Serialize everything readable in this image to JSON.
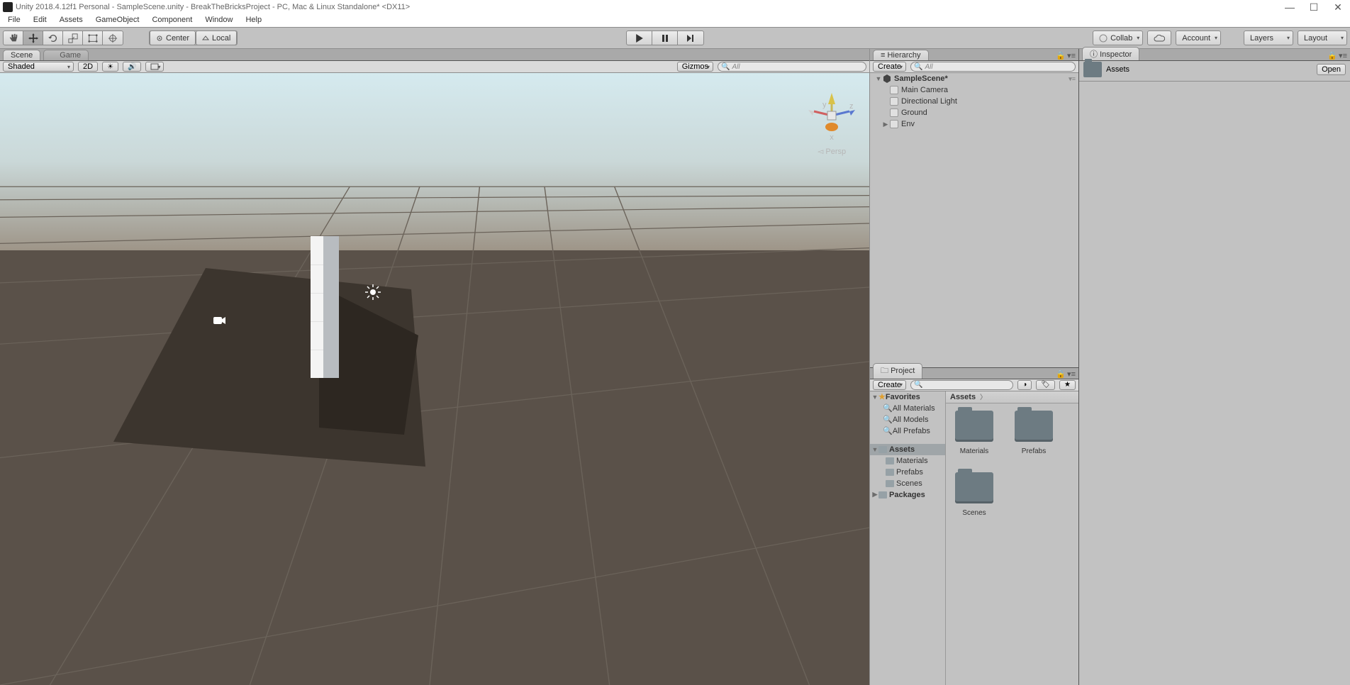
{
  "window": {
    "title": "Unity 2018.4.12f1 Personal - SampleScene.unity - BreakTheBricksProject - PC, Mac & Linux Standalone* <DX11>"
  },
  "menubar": [
    "File",
    "Edit",
    "Assets",
    "GameObject",
    "Component",
    "Window",
    "Help"
  ],
  "toolbar": {
    "pivot_label": "Center",
    "space_label": "Local",
    "collab_label": "Collab",
    "account_label": "Account",
    "layers_label": "Layers",
    "layout_label": "Layout"
  },
  "scene_panel": {
    "tabs": {
      "scene": "Scene",
      "game": "Game"
    },
    "shade_mode": "Shaded",
    "mode_2d": "2D",
    "gizmos_label": "Gizmos",
    "search_placeholder": "All",
    "axis_x": "x",
    "axis_y": "y",
    "axis_z": "z",
    "persp": "Persp"
  },
  "hierarchy": {
    "tab": "Hierarchy",
    "create": "Create",
    "search_placeholder": "All",
    "scene_name": "SampleScene*",
    "items": [
      {
        "label": "Main Camera",
        "foldable": false
      },
      {
        "label": "Directional Light",
        "foldable": false
      },
      {
        "label": "Ground",
        "foldable": false
      },
      {
        "label": "Env",
        "foldable": true
      }
    ]
  },
  "project": {
    "tab": "Project",
    "create": "Create",
    "breadcrumb": "Assets",
    "favorites": {
      "label": "Favorites",
      "items": [
        "All Materials",
        "All Models",
        "All Prefabs"
      ]
    },
    "assets": {
      "label": "Assets",
      "items": [
        "Materials",
        "Prefabs",
        "Scenes"
      ]
    },
    "packages_label": "Packages",
    "thumbs": [
      {
        "label": "Materials"
      },
      {
        "label": "Prefabs"
      },
      {
        "label": "Scenes"
      }
    ]
  },
  "inspector": {
    "tab": "Inspector",
    "title": "Assets",
    "open_btn": "Open"
  }
}
